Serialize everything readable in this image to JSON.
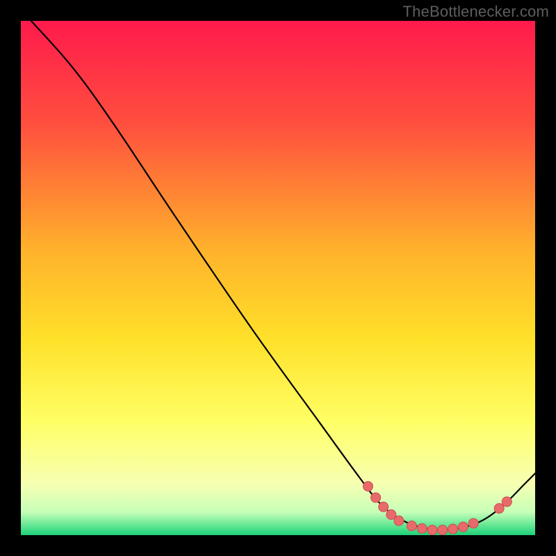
{
  "attribution": "TheBottlenecker.com",
  "chart_data": {
    "type": "line",
    "title": "",
    "xlabel": "",
    "ylabel": "",
    "xlim": [
      0,
      100
    ],
    "ylim": [
      0,
      100
    ],
    "gradient_stops": [
      {
        "offset": 0,
        "color": "#ff1a4c"
      },
      {
        "offset": 0.2,
        "color": "#ff4f3e"
      },
      {
        "offset": 0.45,
        "color": "#ffb32b"
      },
      {
        "offset": 0.62,
        "color": "#ffe12a"
      },
      {
        "offset": 0.78,
        "color": "#ffff66"
      },
      {
        "offset": 0.9,
        "color": "#f7ffb2"
      },
      {
        "offset": 0.955,
        "color": "#c7ffb8"
      },
      {
        "offset": 0.985,
        "color": "#54e38e"
      },
      {
        "offset": 1.0,
        "color": "#1ecf7a"
      }
    ],
    "series": [
      {
        "name": "curve",
        "points": [
          {
            "x": 2,
            "y": 100
          },
          {
            "x": 10,
            "y": 91
          },
          {
            "x": 18,
            "y": 80
          },
          {
            "x": 30,
            "y": 62
          },
          {
            "x": 45,
            "y": 40
          },
          {
            "x": 58,
            "y": 22
          },
          {
            "x": 66,
            "y": 11
          },
          {
            "x": 70,
            "y": 6
          },
          {
            "x": 74,
            "y": 3
          },
          {
            "x": 78,
            "y": 1.5
          },
          {
            "x": 82,
            "y": 1
          },
          {
            "x": 86,
            "y": 1.5
          },
          {
            "x": 90,
            "y": 3
          },
          {
            "x": 94,
            "y": 6
          },
          {
            "x": 98,
            "y": 10
          },
          {
            "x": 100,
            "y": 12
          }
        ]
      }
    ],
    "markers": [
      {
        "x": 67.5,
        "y": 9.5
      },
      {
        "x": 69.0,
        "y": 7.3
      },
      {
        "x": 70.5,
        "y": 5.5
      },
      {
        "x": 72.0,
        "y": 4.0
      },
      {
        "x": 73.5,
        "y": 2.8
      },
      {
        "x": 76.0,
        "y": 1.8
      },
      {
        "x": 78.0,
        "y": 1.3
      },
      {
        "x": 80.0,
        "y": 1.0
      },
      {
        "x": 82.0,
        "y": 1.0
      },
      {
        "x": 84.0,
        "y": 1.2
      },
      {
        "x": 86.0,
        "y": 1.6
      },
      {
        "x": 88.0,
        "y": 2.3
      },
      {
        "x": 93.0,
        "y": 5.2
      },
      {
        "x": 94.5,
        "y": 6.5
      }
    ],
    "marker_style": {
      "fill": "#e86a6a",
      "stroke": "#c94f4f",
      "r": 7
    },
    "line_style": {
      "stroke": "#000000",
      "width": 2.2
    }
  }
}
